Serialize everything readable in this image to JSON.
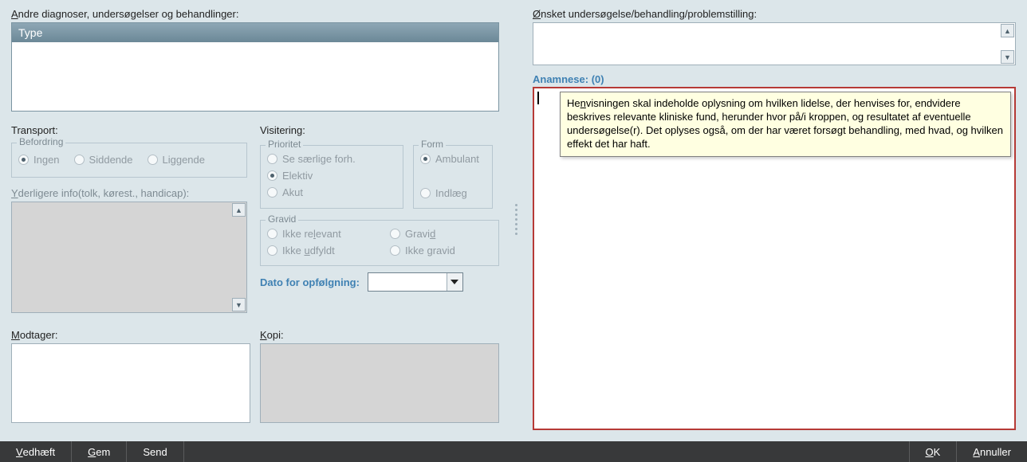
{
  "left": {
    "diag_label_a": "A",
    "diag_label_rest": "ndre diagnoser, undersøgelser og behandlinger:",
    "type_header": "Type",
    "transport": {
      "label": "Transport:",
      "fieldset": "Befordring",
      "ingen": "Ingen",
      "siddende": "Siddende",
      "liggende": "Liggende"
    },
    "visitering": {
      "label": "Visitering:",
      "prioritet": {
        "legend": "Prioritet",
        "se": "Se særlige forh.",
        "elektiv": "Elektiv",
        "akut": "Akut"
      },
      "form": {
        "legend": "Form",
        "ambulant": "Ambulant",
        "indlaeg": "Indlæg"
      },
      "gravid": {
        "legend": "Gravid",
        "ikke_relevant_pre": "Ikke re",
        "ikke_relevant_u": "l",
        "ikke_relevant_post": "evant",
        "gravid_pre": "Gravi",
        "gravid_u": "d",
        "ikke_udfyldt_pre": "Ikke ",
        "ikke_udfyldt_u": "u",
        "ikke_udfyldt_post": "dfyldt",
        "ikke_gravid_pre": "Ikke ",
        "ikke_gravid_u": "g",
        "ikke_gravid_post": "ravid"
      },
      "date_label": "Dato for opfølgning:"
    },
    "yderligere_label_y": "Y",
    "yderligere_rest": "derligere info(tolk, kørest., handicap):",
    "modtager_m": "M",
    "modtager_rest": "odtager:",
    "kopi_k": "K",
    "kopi_rest": "opi:"
  },
  "right": {
    "onsket_o": "Ø",
    "onsket_rest": "nsket undersøgelse/behandling/problemstilling:",
    "anamnese_label": "Anamnese: (0)",
    "tooltip_pre": "He",
    "tooltip_u": "n",
    "tooltip_post": "visningen skal indeholde oplysning om hvilken lidelse, der henvises for, endvidere beskrives relevante kliniske fund, herunder hvor på/i kroppen, og resultatet af eventuelle undersøgelse(r). Det oplyses også, om der har været forsøgt behandling, med hvad, og hvilken effekt det har haft."
  },
  "footer": {
    "vedhaeft_v": "V",
    "vedhaeft_rest": "edhæft",
    "gem_g": "G",
    "gem_rest": "em",
    "send": "Send",
    "ok_o": "O",
    "ok_rest": "K",
    "annuller_a": "A",
    "annuller_rest": "nnuller"
  }
}
